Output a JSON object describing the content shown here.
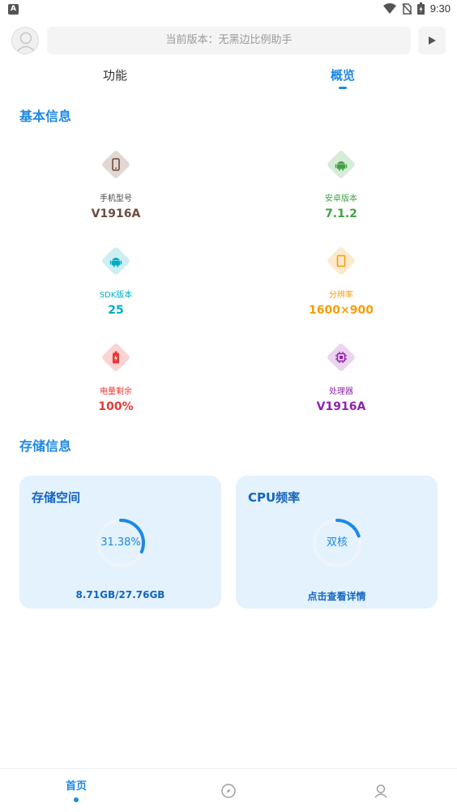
{
  "status_bar": {
    "time": "9:30",
    "left_icon": "A"
  },
  "header": {
    "search_text": "当前版本：无黑边比例助手"
  },
  "tabs": [
    {
      "label": "功能"
    },
    {
      "label": "概览"
    }
  ],
  "basic_info": {
    "title": "基本信息",
    "items": [
      {
        "label": "手机型号",
        "value": "V1916A",
        "icon": "phone-icon",
        "color": "#6d4c41",
        "bg": "#e2d7d2"
      },
      {
        "label": "安卓版本",
        "value": "7.1.2",
        "icon": "android-icon",
        "color": "#43a047",
        "bg": "#d6ecd7"
      },
      {
        "label": "SDK版本",
        "value": "25",
        "icon": "android-icon",
        "color": "#00acc1",
        "bg": "#cdeef3"
      },
      {
        "label": "分辨率",
        "value": "1600×900",
        "icon": "screen-icon",
        "color": "#f59e0b",
        "bg": "#fde9cc"
      },
      {
        "label": "电量剩余",
        "value": "100%",
        "icon": "battery-icon",
        "color": "#e53935",
        "bg": "#fbd3d3"
      },
      {
        "label": "处理器",
        "value": "V1916A",
        "icon": "cpu-icon",
        "color": "#8e24aa",
        "bg": "#ead4f0"
      }
    ]
  },
  "storage_info": {
    "title": "存储信息",
    "cards": [
      {
        "title": "存储空间",
        "center_text": "31.38%",
        "progress": 0.3138,
        "footer": "8.71GB/27.76GB"
      },
      {
        "title": "CPU频率",
        "center_text": "双核",
        "progress": 0.2,
        "footer": "点击查看详情"
      }
    ]
  },
  "bottom_nav": {
    "home_label": "首页"
  },
  "colors": {
    "accent": "#1e88e5",
    "card_bg": "#e3f2fd"
  }
}
